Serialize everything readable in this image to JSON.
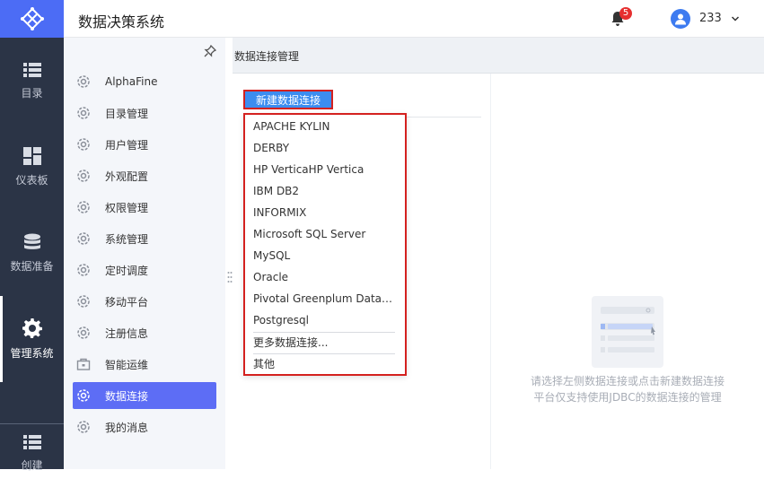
{
  "header": {
    "title": "数据决策系统",
    "notification_count": "5",
    "user_name": "233"
  },
  "rail": {
    "items": [
      {
        "label": "目录",
        "icon": "list-icon"
      },
      {
        "label": "仪表板",
        "icon": "dashboard-icon"
      },
      {
        "label": "数据准备",
        "icon": "database-icon"
      },
      {
        "label": "管理系统",
        "icon": "gear-icon",
        "active": true
      },
      {
        "label": "创建",
        "icon": "list-icon"
      }
    ]
  },
  "submenu": {
    "items": [
      {
        "label": "AlphaFine"
      },
      {
        "label": "目录管理"
      },
      {
        "label": "用户管理"
      },
      {
        "label": "外观配置"
      },
      {
        "label": "权限管理"
      },
      {
        "label": "系统管理"
      },
      {
        "label": "定时调度"
      },
      {
        "label": "移动平台"
      },
      {
        "label": "注册信息"
      },
      {
        "label": "智能运维"
      },
      {
        "label": "数据连接",
        "active": true
      },
      {
        "label": "我的消息"
      }
    ]
  },
  "main": {
    "page_title": "数据连接管理",
    "new_button": "新建数据连接",
    "dropdown": [
      "APACHE KYLIN",
      "DERBY",
      "HP VerticaHP Vertica",
      "IBM DB2",
      "INFORMIX",
      "Microsoft SQL Server",
      "MySQL",
      "Oracle",
      "Pivotal Greenplum Databa...",
      "Postgresql"
    ],
    "more_label": "更多数据连接...",
    "other_label": "其他",
    "empty_line1": "请选择左侧数据连接或点击新建数据连接",
    "empty_line2": "平台仅支持使用JDBC的数据连接的管理"
  },
  "colors": {
    "accent": "#5d6df5",
    "rail_bg": "#2b3446",
    "highlight_border": "#d4211f",
    "button_blue": "#3c8df0"
  }
}
